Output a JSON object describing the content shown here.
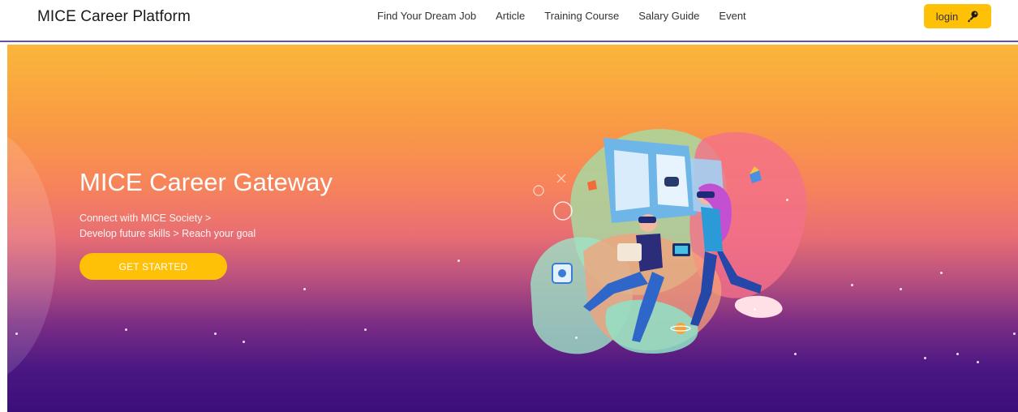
{
  "header": {
    "brand": "MICE Career Platform",
    "nav": [
      "Find Your Dream Job",
      "Article",
      "Training Course",
      "Salary Guide",
      "Event"
    ],
    "login_label": "login",
    "login_icon": "key-icon"
  },
  "hero": {
    "title": "MICE Career Gateway",
    "subtitle_line1": "Connect with MICE Society >",
    "subtitle_line2": "Develop future skills > Reach your goal",
    "cta_label": "GET STARTED"
  },
  "colors": {
    "accent": "#ffc107",
    "header_border": "#6a4f9a",
    "gradient_top": "#fbb63a",
    "gradient_bottom": "#3a0f7a"
  }
}
